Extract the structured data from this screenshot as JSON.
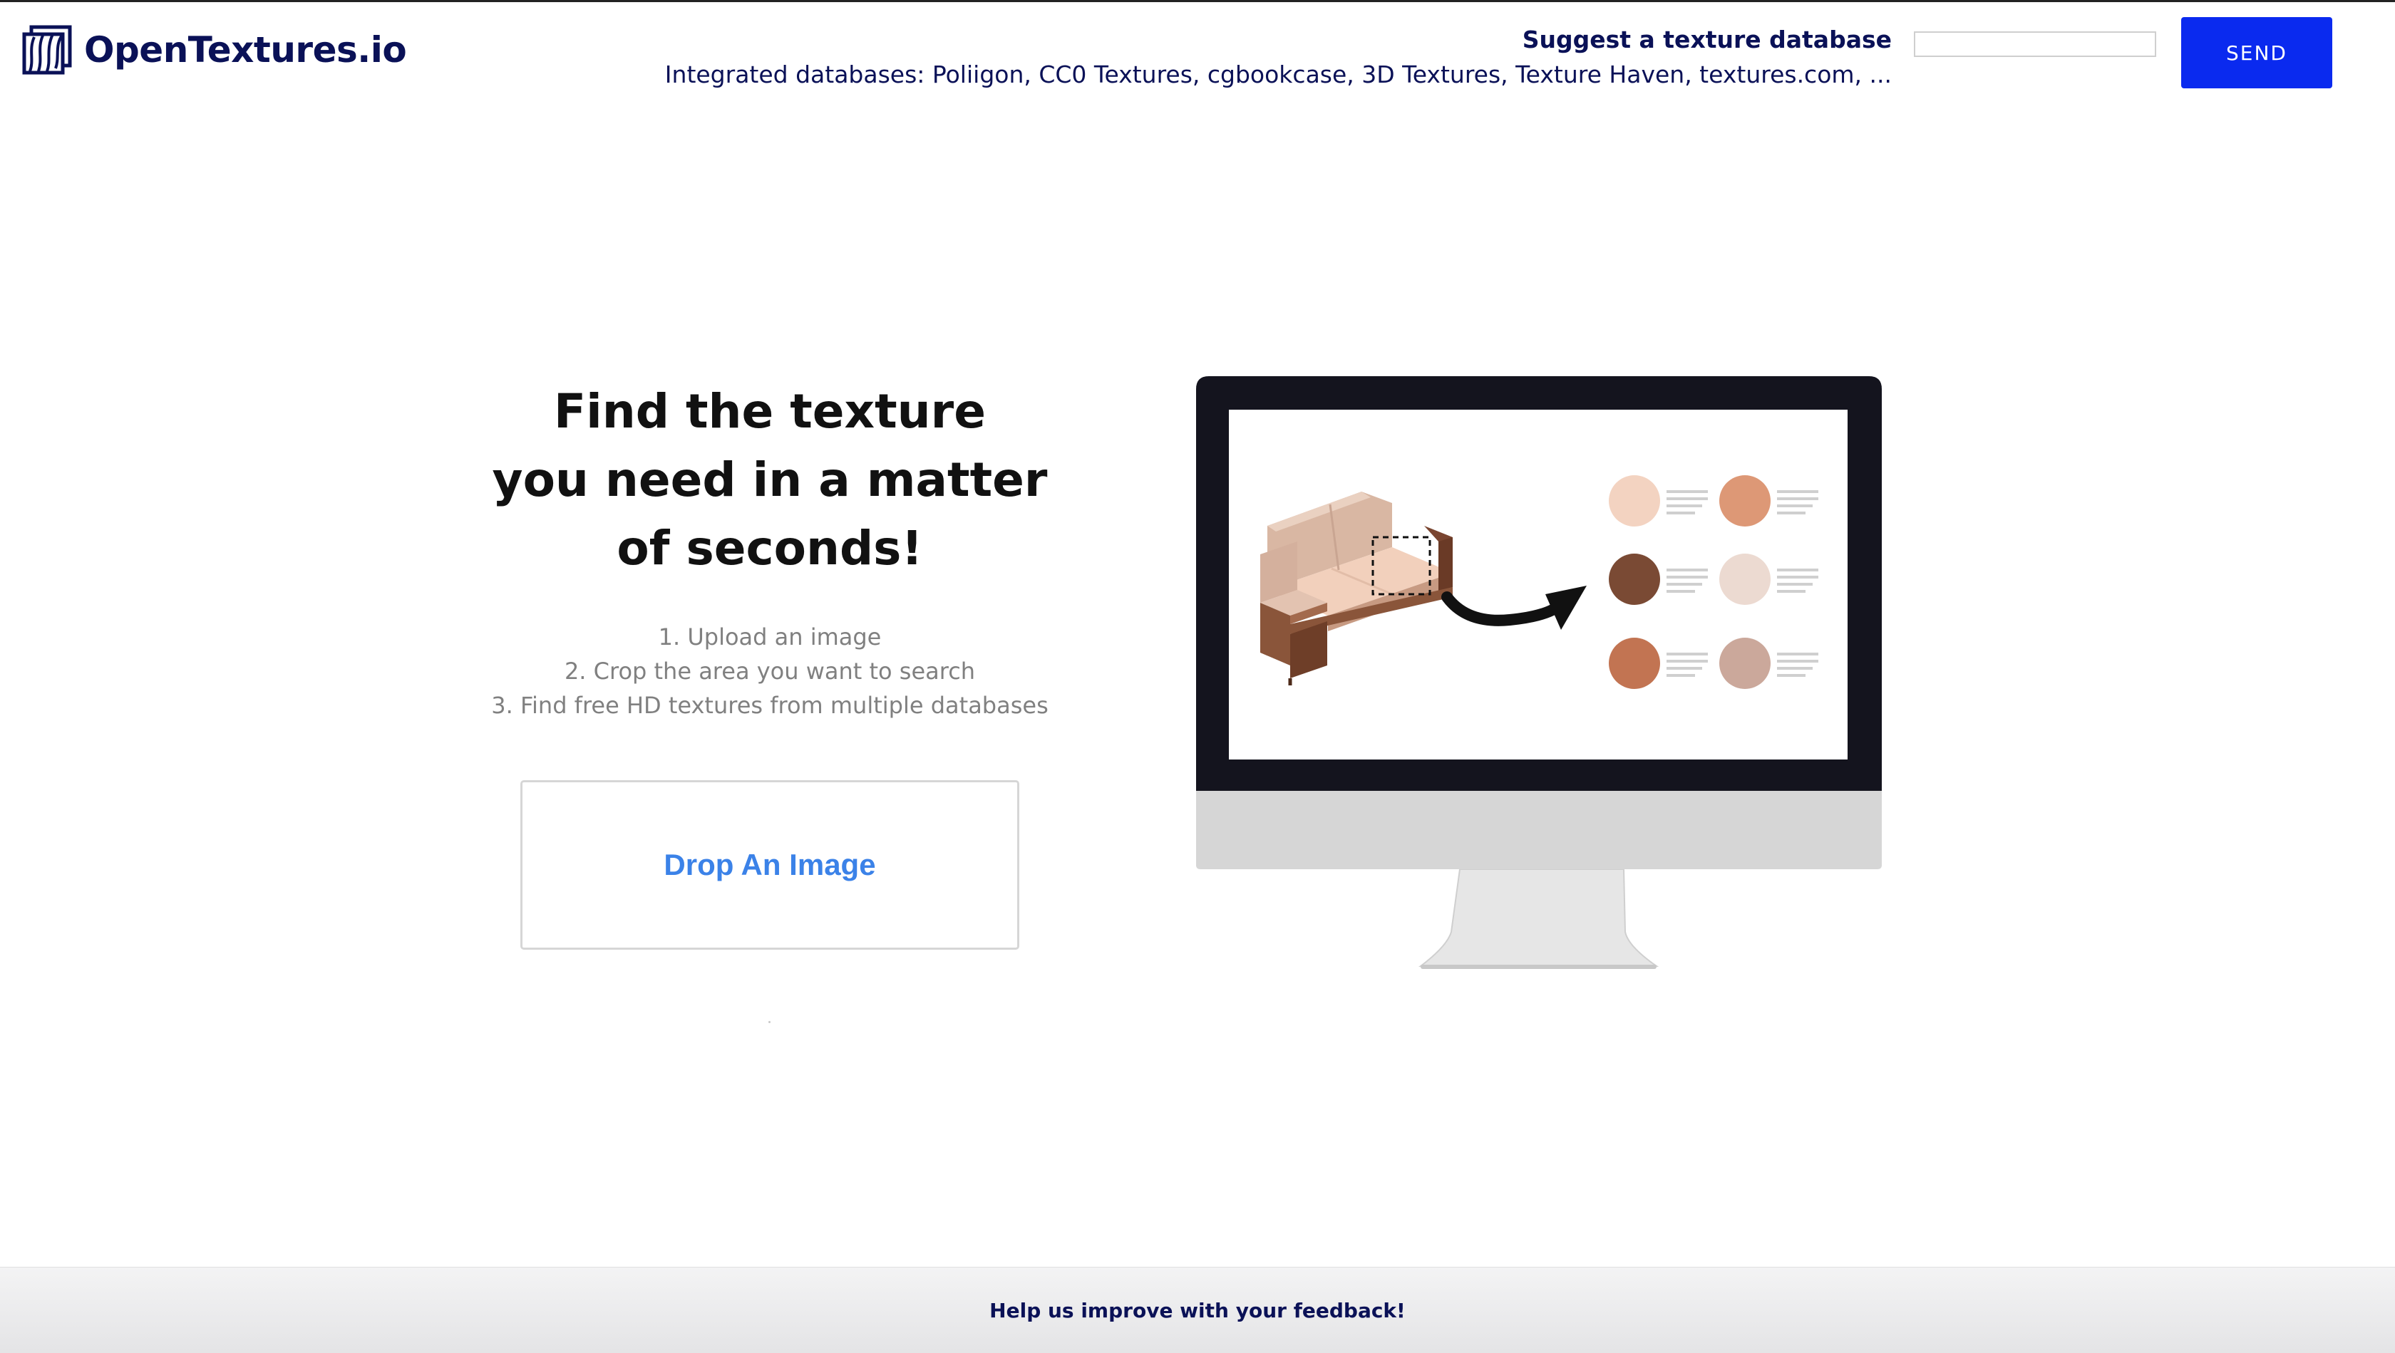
{
  "header": {
    "logo_text": "OpenTextures.io",
    "suggest_label": "Suggest a texture database",
    "suggest_placeholder": "",
    "send_label": "SEND",
    "integrated_text": "Integrated databases: Poliigon, CC0 Textures, cgbookcase, 3D Textures, Texture Haven, textures.com, ..."
  },
  "hero": {
    "headline_lines": [
      "Find the texture",
      "you need in a matter",
      "of seconds!"
    ],
    "steps": [
      "1. Upload an image",
      "2. Crop the area you want to search",
      "3. Find free HD textures from multiple databases"
    ],
    "drop_label": "Drop An Image"
  },
  "illustration": {
    "swatches": [
      "#f3d3c1",
      "#dd9876",
      "#7a4a34",
      "#ecdad1",
      "#c27452",
      "#cba89b"
    ]
  },
  "footer": {
    "feedback_label": "Help us improve with your feedback!"
  },
  "colors": {
    "brand_navy": "#0a1157",
    "send_blue": "#0a2aef",
    "drop_blue": "#3b82e8",
    "step_gray": "#808080"
  }
}
